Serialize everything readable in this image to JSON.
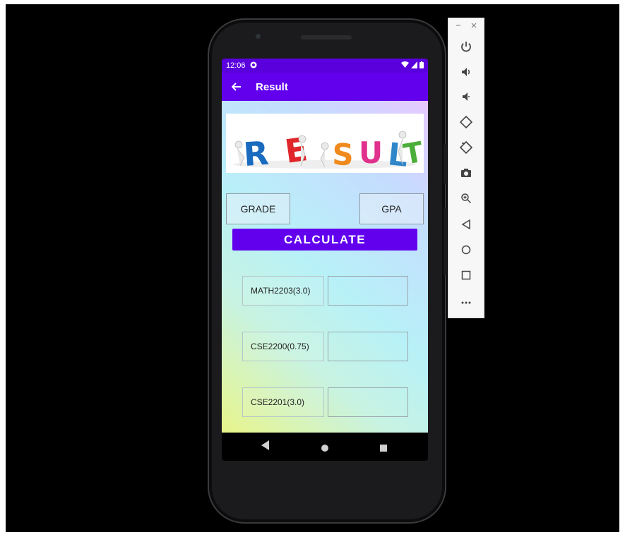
{
  "status_bar": {
    "time": "12:06"
  },
  "app_bar": {
    "title": "Result"
  },
  "banner": {
    "letters": [
      "R",
      "E",
      "S",
      "U",
      "L",
      "T"
    ]
  },
  "buttons": {
    "grade": "GRADE",
    "gpa": "GPA",
    "calculate": "CALCULATE"
  },
  "courses": [
    {
      "label": "MATH2203(3.0)",
      "value": ""
    },
    {
      "label": "CSE2200(0.75)",
      "value": ""
    },
    {
      "label": "CSE2201(3.0)",
      "value": ""
    },
    {
      "label": "",
      "value": ""
    }
  ],
  "colors": {
    "app_bar": "#6200ee",
    "status_bar": "#5a00dd",
    "banner_letters": [
      "#1a6bbf",
      "#e0262a",
      "#f08a1c",
      "#e0318d",
      "#2f86c8",
      "#4cae3a"
    ]
  },
  "emulator_toolbar": {
    "window_controls": [
      "minimize-icon",
      "close-icon"
    ],
    "tools": [
      "power-icon",
      "volume-up-icon",
      "volume-down-icon",
      "rotate-left-icon",
      "rotate-right-icon",
      "camera-icon",
      "zoom-icon",
      "back-icon",
      "home-icon",
      "overview-icon",
      "more-icon"
    ]
  }
}
